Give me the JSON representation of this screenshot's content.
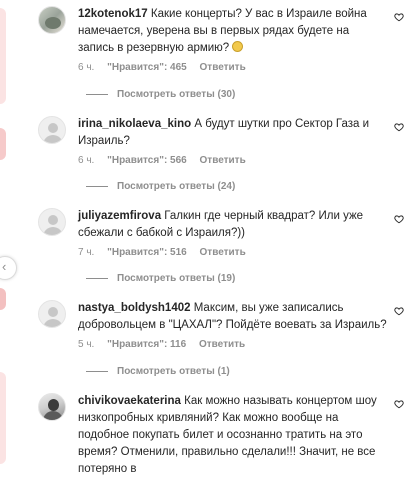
{
  "comments": [
    {
      "username": "12kotenok17",
      "text": "Какие концерты? У вас в Израиле война намечается, уверена вы в первых рядах будете на запись в резервную армию?",
      "emoji_icon": "confused-face-emoji",
      "time": "6 ч.",
      "likes": "\"Нравится\": 465",
      "reply": "Ответить",
      "view_replies": "Посмотреть ответы (30)",
      "avatar": "photo"
    },
    {
      "username": "irina_nikolaeva_kino",
      "text": "А будут шутки про Сектор Газа и Израиль?",
      "time": "6 ч.",
      "likes": "\"Нравится\": 566",
      "reply": "Ответить",
      "view_replies": "Посмотреть ответы (24)",
      "avatar": "default"
    },
    {
      "username": "juliyazemfirova",
      "text": "Галкин где черный квадрат? Или уже сбежали с бабкой с Израиля?))",
      "time": "7 ч.",
      "likes": "\"Нравится\": 516",
      "reply": "Ответить",
      "view_replies": "Посмотреть ответы (19)",
      "avatar": "default"
    },
    {
      "username": "nastya_boldysh1402",
      "text": "Максим, вы уже записались добровольцем в \"ЦАХАЛ\"? Пойдёте воевать за Израиль?",
      "time": "5 ч.",
      "likes": "\"Нравится\": 116",
      "reply": "Ответить",
      "view_replies": "Посмотреть ответы (1)",
      "avatar": "default"
    },
    {
      "username": "chivikovaekaterina",
      "text": "Как можно называть концертом шоу низкопробных кривляний? Как можно вообще на подобное покупать билет и осознанно тратить на это время? Отменили, правильно сделали!!! Значит, не все потеряно в",
      "avatar": "photo"
    }
  ],
  "icons": {
    "like": "heart-outline-icon",
    "scroll": "chevron-left-icon"
  },
  "colors": {
    "text": "#262626",
    "secondary": "#8e8e8e",
    "background": "#ffffff"
  }
}
